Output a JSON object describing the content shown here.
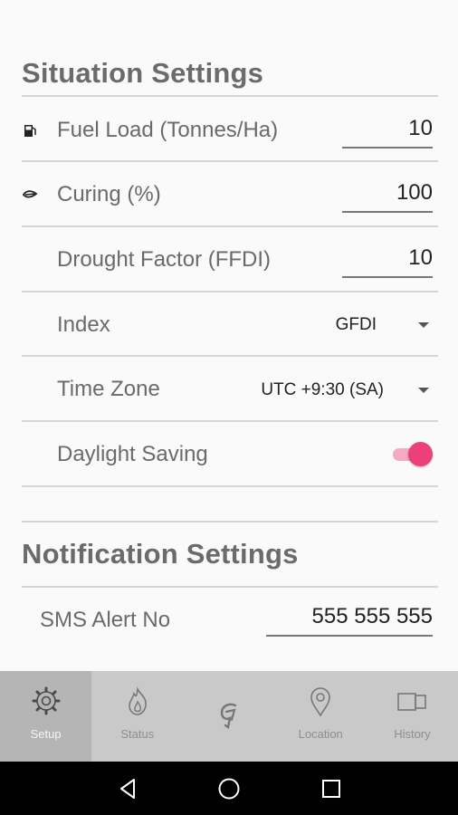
{
  "situation": {
    "title": "Situation Settings",
    "fuel_load": {
      "label": "Fuel Load (Tonnes/Ha)",
      "value": "10",
      "icon": "fuel-pump-icon"
    },
    "curing": {
      "label": "Curing (%)",
      "value": "100",
      "icon": "curing-icon"
    },
    "drought": {
      "label": "Drought Factor (FFDI)",
      "value": "10"
    },
    "index": {
      "label": "Index",
      "value": "GFDI"
    },
    "timezone": {
      "label": "Time Zone",
      "value": "UTC +9:30 (SA)"
    },
    "daylight": {
      "label": "Daylight Saving",
      "enabled": true
    }
  },
  "notification": {
    "title": "Notification Settings",
    "sms": {
      "label": "SMS Alert No",
      "value": "555 555 555"
    }
  },
  "nav": {
    "items": [
      {
        "label": "Setup",
        "icon": "gear-icon",
        "active": true
      },
      {
        "label": "Status",
        "icon": "fire-icon",
        "active": false
      },
      {
        "label": "",
        "icon": "logo-icon",
        "active": false
      },
      {
        "label": "Location",
        "icon": "map-pin-icon",
        "active": false
      },
      {
        "label": "History",
        "icon": "history-icon",
        "active": false
      }
    ]
  },
  "colors": {
    "accent": "#ec407a",
    "accent_light": "#f5a9c4",
    "nav_bg": "#c9c9c9"
  }
}
